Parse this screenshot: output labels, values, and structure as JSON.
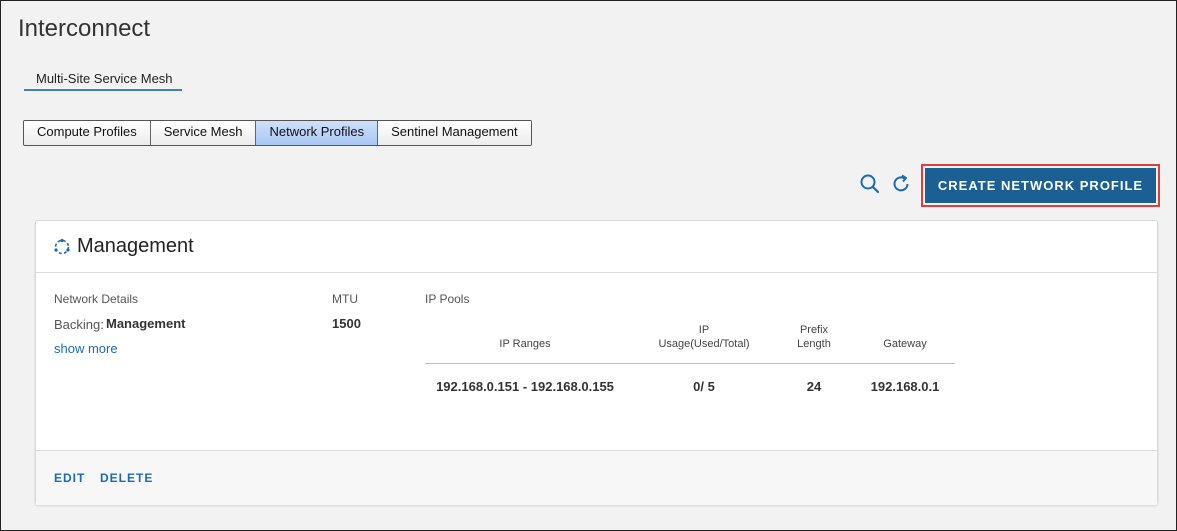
{
  "page": {
    "title": "Interconnect"
  },
  "top_tabs": [
    {
      "label": "Multi-Site Service Mesh",
      "selected": true
    }
  ],
  "subtabs": [
    {
      "label": "Compute Profiles",
      "active": false
    },
    {
      "label": "Service Mesh",
      "active": false
    },
    {
      "label": "Network Profiles",
      "active": true
    },
    {
      "label": "Sentinel Management",
      "active": false
    }
  ],
  "toolbar": {
    "search_icon": "search-icon",
    "refresh_icon": "refresh-icon",
    "create_label": "CREATE NETWORK PROFILE"
  },
  "card": {
    "title": "Management",
    "icon": "network-icon",
    "network_details_label": "Network Details",
    "backing_label": "Backing:",
    "backing_value": "Management",
    "show_more": "show more",
    "mtu_label": "MTU",
    "mtu_value": "1500",
    "ip_pools_label": "IP Pools",
    "columns": {
      "ip_ranges": "IP Ranges",
      "ip_usage_1": "IP",
      "ip_usage_2": "Usage(Used/Total)",
      "prefix_1": "Prefix",
      "prefix_2": "Length",
      "gateway": "Gateway"
    },
    "rows": [
      {
        "ip_ranges": "192.168.0.151 - 192.168.0.155",
        "ip_usage": "0/ 5",
        "prefix_length": "24",
        "gateway": "192.168.0.1"
      }
    ],
    "footer": {
      "edit": "EDIT",
      "delete": "DELETE"
    }
  },
  "colors": {
    "accent": "#1c5f93",
    "link": "#1c6bb0",
    "highlight_border": "#e23b3b",
    "active_tab": "#b9d2f7"
  }
}
